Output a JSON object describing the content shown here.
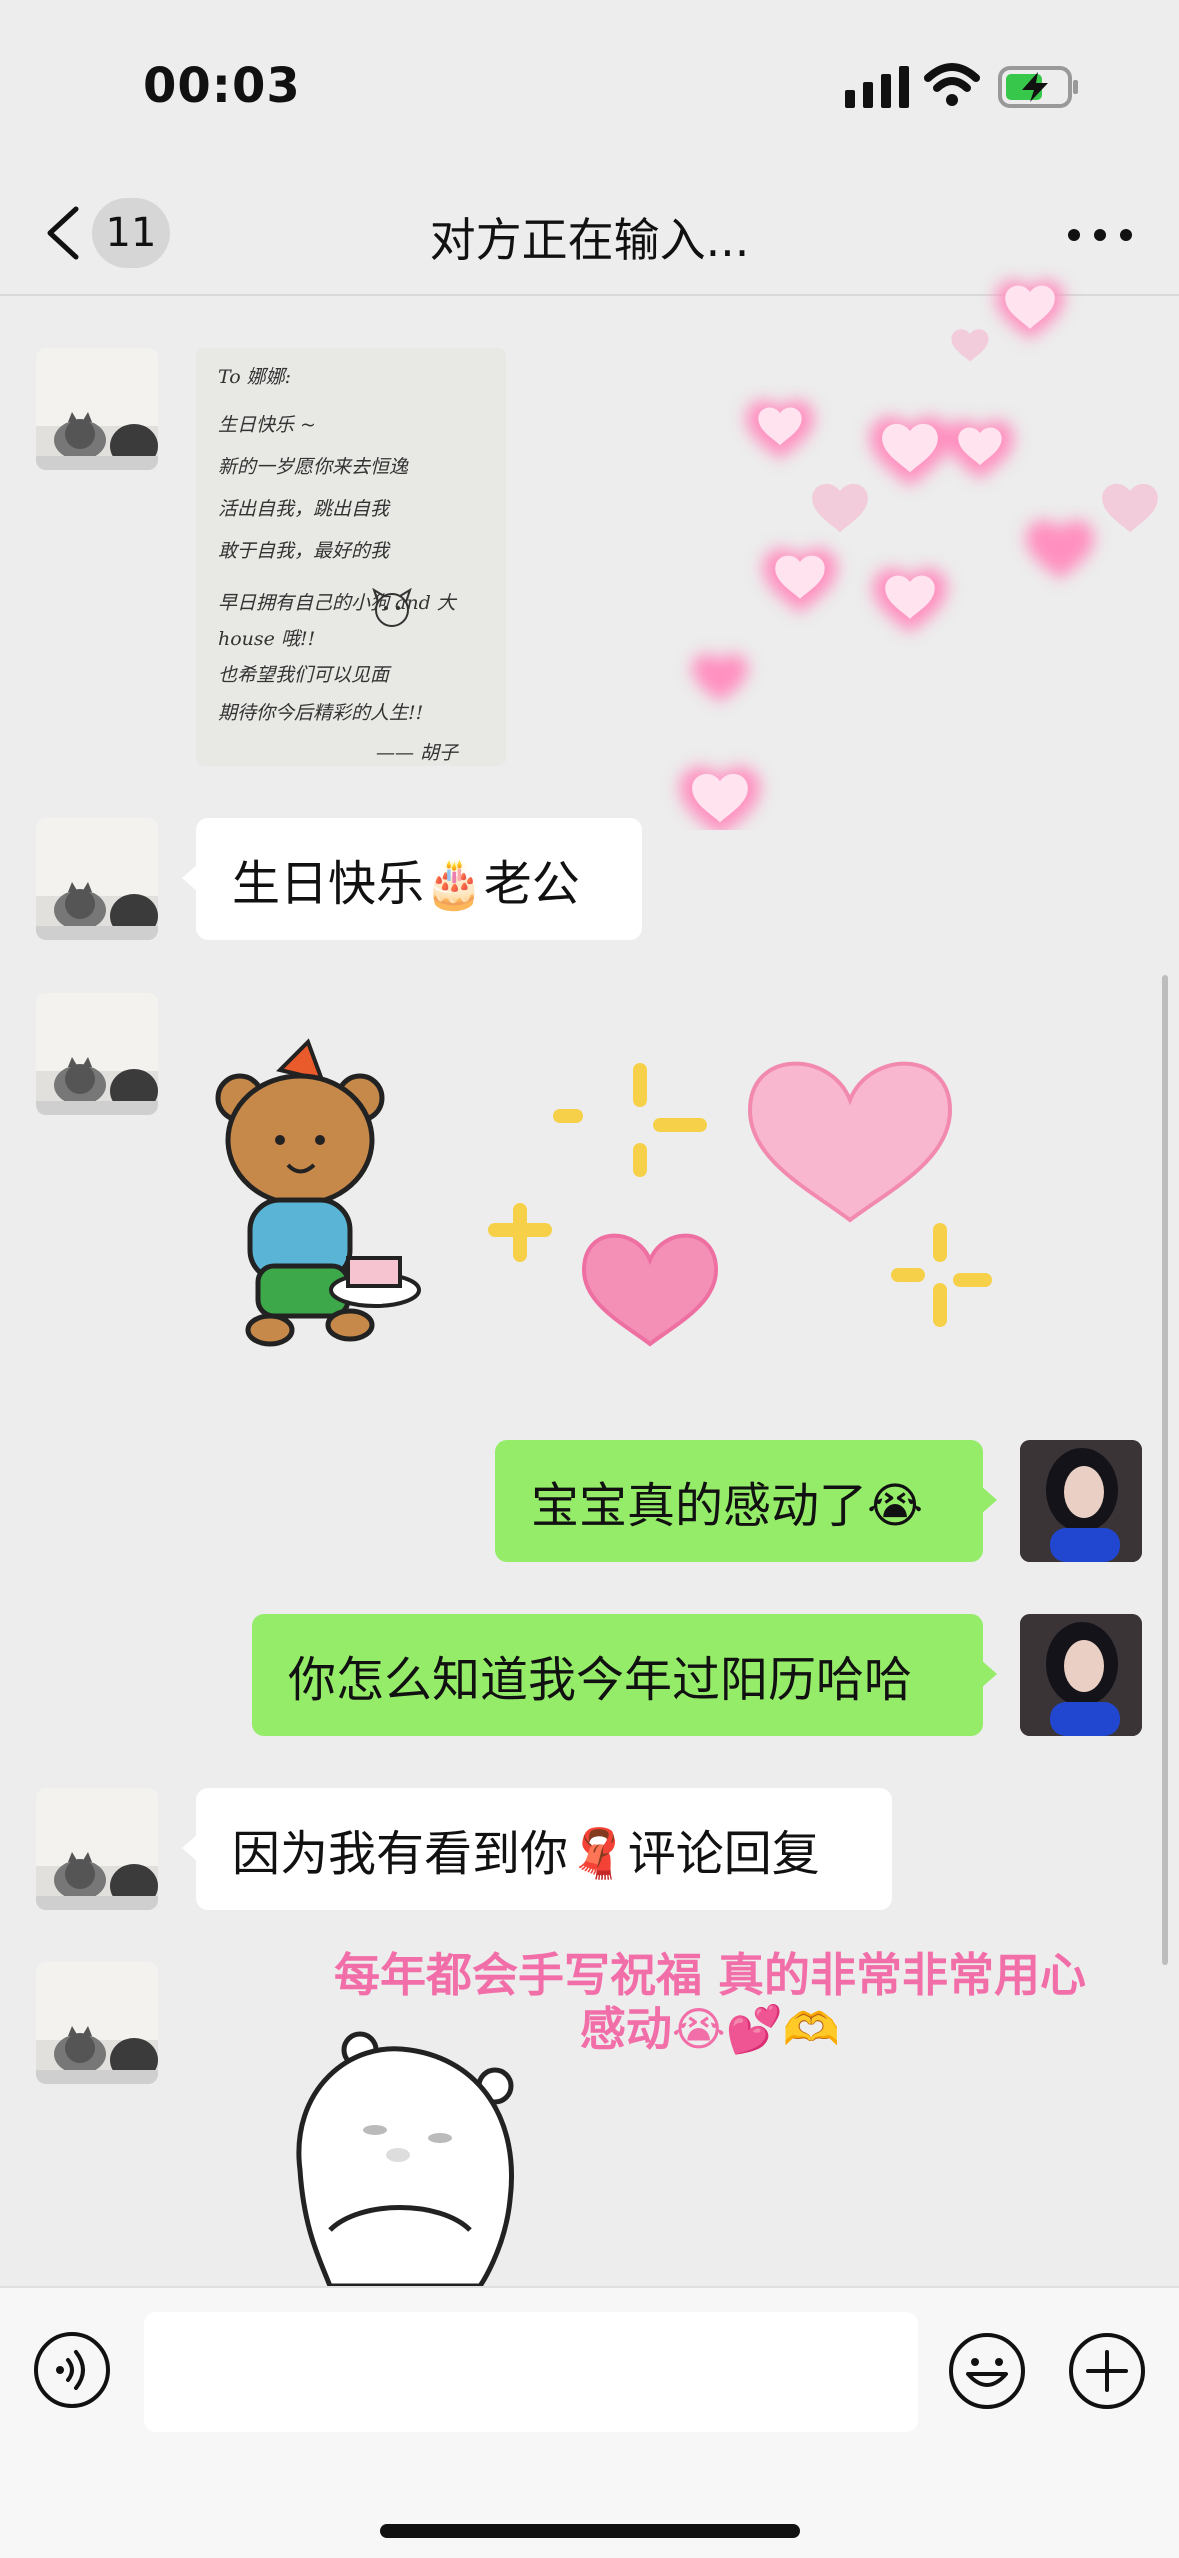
{
  "status": {
    "time": "00:03"
  },
  "nav": {
    "back_count": "11",
    "title": "对方正在输入..."
  },
  "messages": {
    "m2_text": "生日快乐🎂老公",
    "m4_text": "宝宝真的感动了😭",
    "m5_text": "你怎么知道我今年过阳历哈哈",
    "m6_text": "因为我有看到你🧣评论回复"
  },
  "letter": {
    "lines": [
      "To 娜娜:",
      "生日快乐 ~",
      "新的一岁愿你来去恒逸",
      "活出自我，跳出自我",
      "敢于自我，最好的我",
      "早日拥有自己的小狗 and 大",
      "house 哦!!",
      "也希望我们可以见面",
      "期待你今后精彩的人生!!",
      "—— 胡子"
    ]
  },
  "overlay": {
    "line1": "每年都会手写祝福 真的非常非常用心",
    "line2": "感动😭💕🫶"
  },
  "input": {
    "value": ""
  },
  "colors": {
    "sent_bubble": "#95ec69",
    "received_bubble": "#ffffff",
    "background": "#ededed",
    "overlay_text": "#f26ea8"
  }
}
